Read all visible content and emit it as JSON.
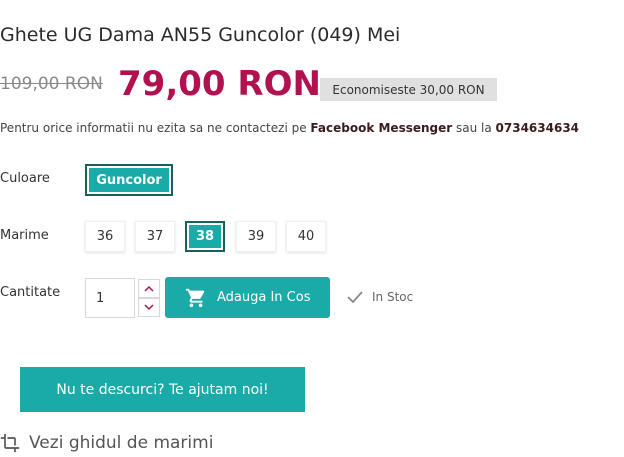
{
  "product": {
    "title": "Ghete UG Dama AN55 Guncolor (049) Mei",
    "old_price": "109,00 RON",
    "new_price": "79,00 RON",
    "savings": "Economiseste 30,00 RON"
  },
  "contact": {
    "prefix": "Pentru orice informatii nu ezita sa ne contactezi pe ",
    "messenger": "Facebook Messenger",
    "middle": " sau la ",
    "phone": "0734634634"
  },
  "options": {
    "color_label": "Culoare",
    "color_value": "Guncolor",
    "size_label": "Marime",
    "sizes": [
      "36",
      "37",
      "38",
      "39",
      "40"
    ],
    "selected_size": "38",
    "qty_label": "Cantitate",
    "qty_value": "1"
  },
  "actions": {
    "add_to_cart": "Adauga In Cos",
    "stock_status": "In Stoc",
    "help": "Nu te descurci? Te ajutam noi!",
    "size_guide": "Vezi ghidul de marimi"
  },
  "colors": {
    "accent": "#1aaba8",
    "accent_dark": "#1a5f5c",
    "price": "#b0124f",
    "badge_bg": "#e0e0e0"
  },
  "icons": {
    "cart": "shopping-cart-icon",
    "stock": "check-icon",
    "guide": "crop-icon",
    "qty_up": "chevron-up-icon",
    "qty_down": "chevron-down-icon"
  }
}
